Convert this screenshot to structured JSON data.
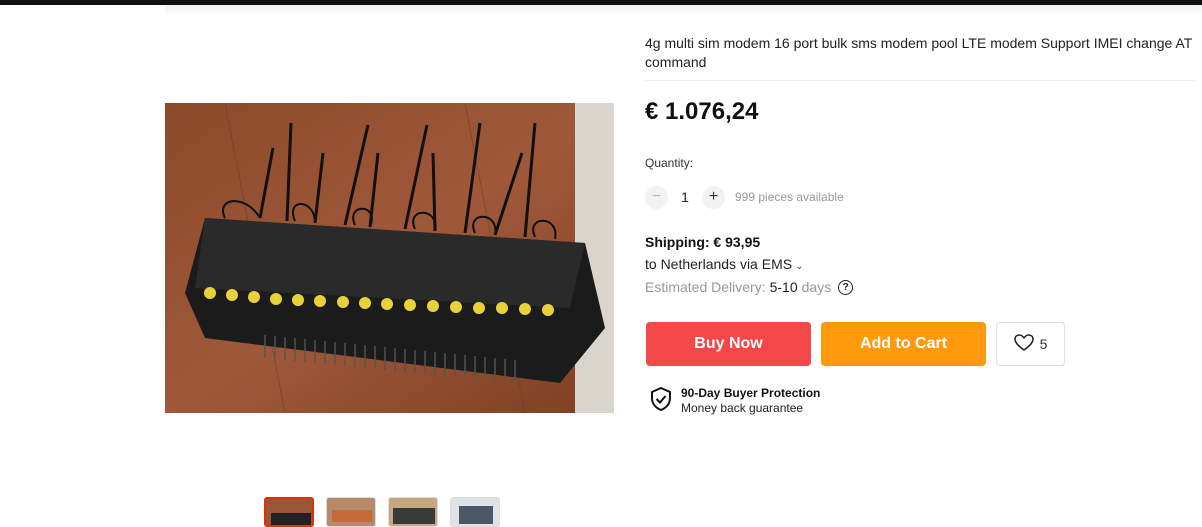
{
  "product": {
    "title": "4g multi sim modem 16 port bulk sms modem pool LTE modem Support IMEI change AT command",
    "price": "€ 1.076,24",
    "image_alt": "16 port modem pool with antennas"
  },
  "quantity": {
    "label": "Quantity:",
    "minus": "−",
    "value": "1",
    "plus": "+",
    "available": "999 pieces available"
  },
  "shipping": {
    "cost": "Shipping: € 93,95",
    "destination": "to Netherlands via EMS",
    "delivery_label": "Estimated Delivery:",
    "delivery_days": "5-10",
    "delivery_unit": "days",
    "help": "?"
  },
  "actions": {
    "buy_now": "Buy Now",
    "add_to_cart": "Add to Cart",
    "wishlist_count": "5"
  },
  "protection": {
    "title": "90-Day Buyer Protection",
    "subtitle": "Money back guarantee"
  },
  "colors": {
    "buy_now": "#f4474a",
    "add_to_cart": "#ff9a0e",
    "active_thumb": "#e62e04"
  },
  "icons": [
    "chevron-down-icon",
    "help-circle-icon",
    "heart-icon",
    "shield-check-icon"
  ]
}
